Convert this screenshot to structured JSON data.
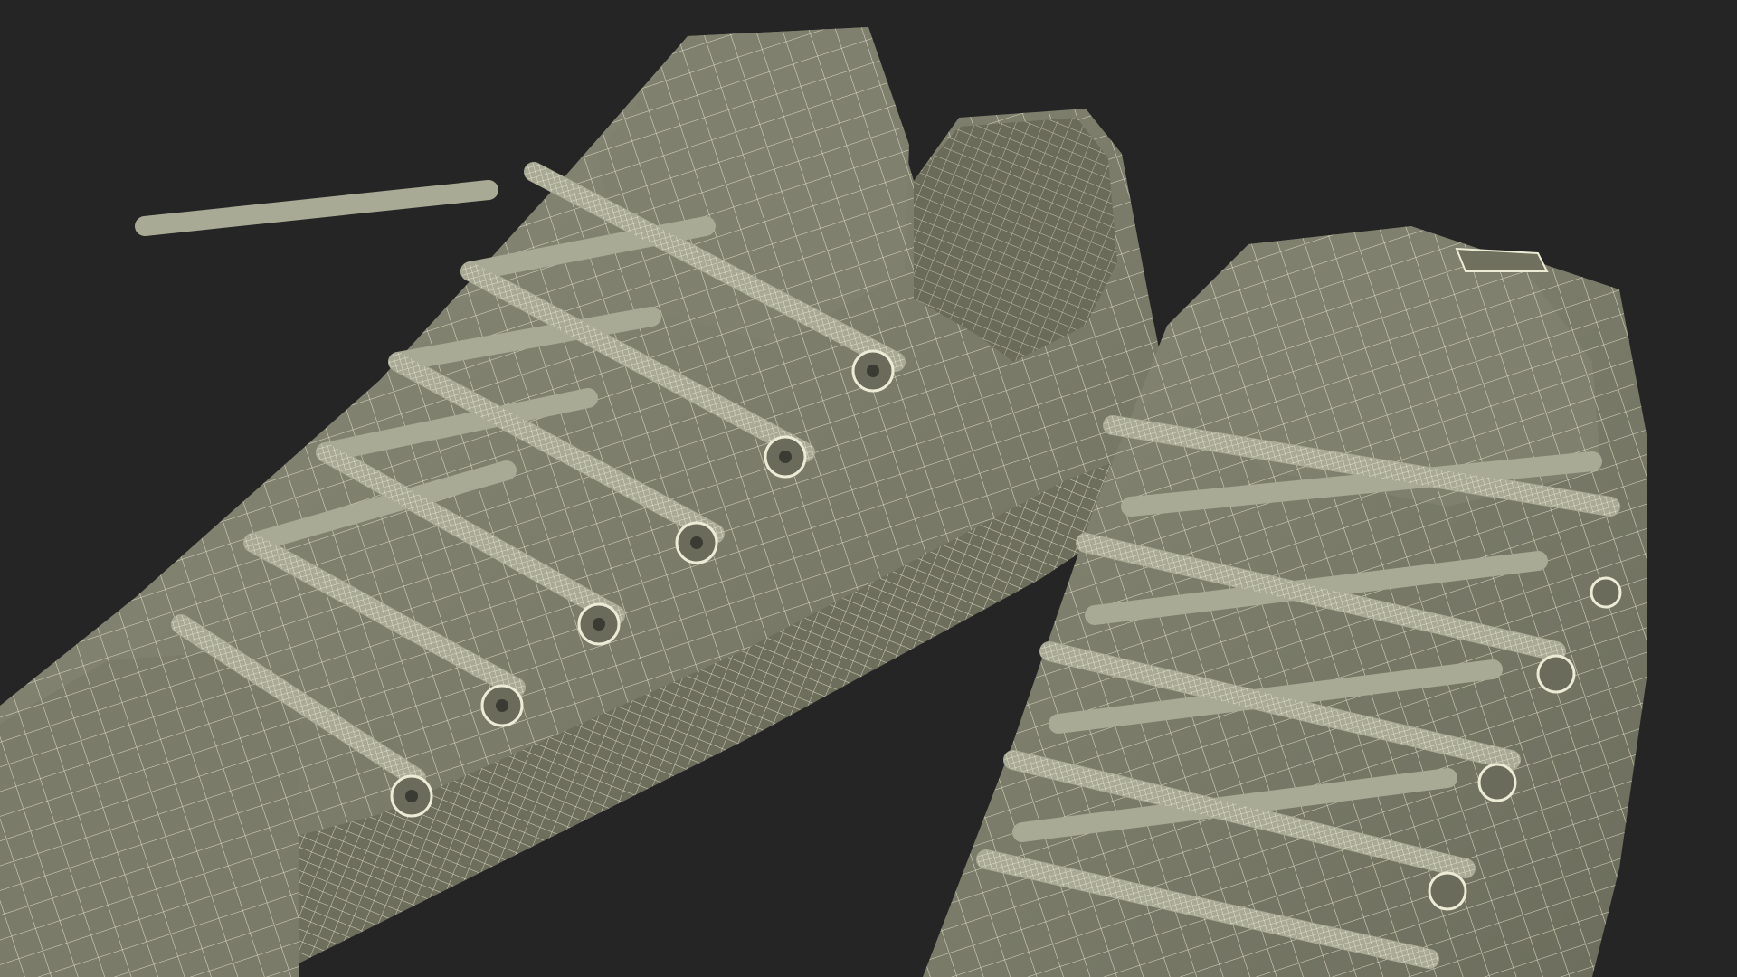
{
  "scene": {
    "subject": "wireframe-sneakers-pair",
    "colors": {
      "background": "#252525",
      "surface": "#7c7d6b",
      "surface_light": "#8b8c79",
      "surface_dark": "#5f604f",
      "wire": "#ecebd6",
      "lace": "#a7a893"
    }
  }
}
